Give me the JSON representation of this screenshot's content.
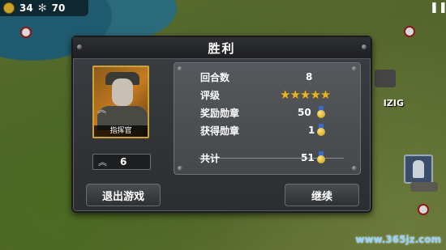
{
  "hud": {
    "coins": "34",
    "supplies": "70",
    "coin_icon": "coin-icon",
    "supply_icon": "gear-icon",
    "pause_icon": "pause-icon"
  },
  "map": {
    "city_label": "IZIG",
    "watermark": "www.365jz.com"
  },
  "dialog": {
    "title": "胜利",
    "commander": {
      "role": "指挥官",
      "level": "6"
    },
    "stats": {
      "rounds_label": "回合数",
      "rounds_value": "8",
      "rating_label": "评级",
      "rating_stars": 5,
      "reward_label": "奖励勋章",
      "reward_value": "50",
      "earned_label": "获得勋章",
      "earned_value": "1",
      "total_label": "共计",
      "total_value": "51"
    },
    "buttons": {
      "exit": "退出游戏",
      "continue": "继续"
    }
  },
  "colors": {
    "accent_gold": "#e8b423",
    "panel": "#3b3e42",
    "medal_ribbon": "#3a6acc"
  }
}
